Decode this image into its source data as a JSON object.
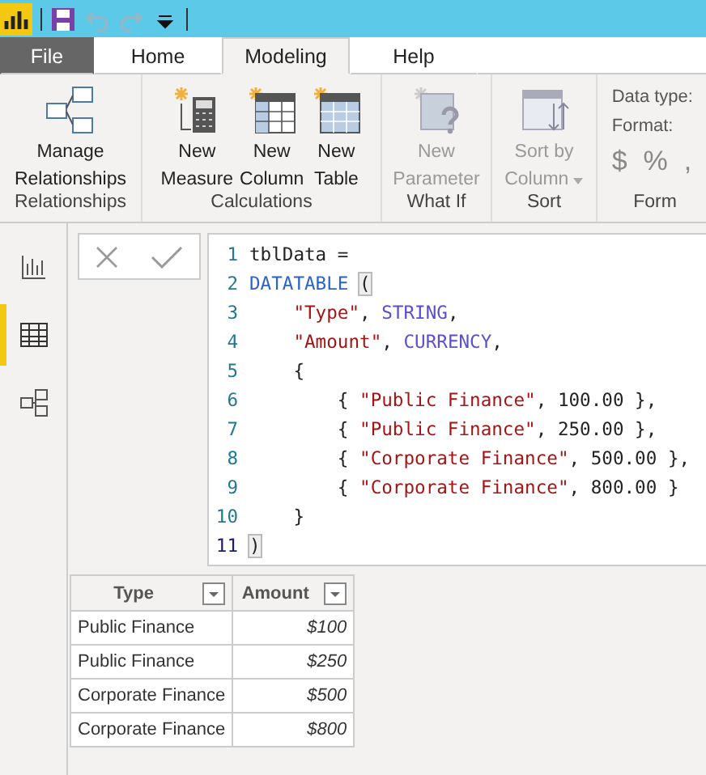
{
  "quick_access": {
    "undo_disabled": true,
    "redo_disabled": true
  },
  "tabs": [
    {
      "label": "File",
      "kind": "file",
      "selected": false
    },
    {
      "label": "Home",
      "kind": "tab",
      "selected": false
    },
    {
      "label": "Modeling",
      "kind": "tab",
      "selected": true
    },
    {
      "label": "Help",
      "kind": "tab",
      "selected": false
    }
  ],
  "ribbon_groups": [
    {
      "label": "Relationships",
      "buttons": [
        {
          "lines": [
            "Manage",
            "Relationships"
          ],
          "disabled": false
        }
      ]
    },
    {
      "label": "Calculations",
      "buttons": [
        {
          "lines": [
            "New",
            "Measure"
          ],
          "disabled": false
        },
        {
          "lines": [
            "New",
            "Column"
          ],
          "disabled": false
        },
        {
          "lines": [
            "New",
            "Table"
          ],
          "disabled": false
        }
      ]
    },
    {
      "label": "What If",
      "buttons": [
        {
          "lines": [
            "New",
            "Parameter"
          ],
          "disabled": true
        }
      ]
    },
    {
      "label": "Sort",
      "buttons": [
        {
          "lines": [
            "Sort by",
            "Column"
          ],
          "disabled": true,
          "dropdown": true
        }
      ]
    },
    {
      "label": "Form",
      "kind": "format",
      "data_type_label": "Data type:",
      "format_label": "Format:",
      "symbols": [
        "$",
        "%",
        ","
      ]
    }
  ],
  "sidebar": [
    {
      "selected": false
    },
    {
      "selected": true
    },
    {
      "selected": false
    }
  ],
  "formula_bar": {
    "lines": [
      {
        "number": "1",
        "tokens": [
          {
            "text": "tblData =",
            "kind": "plain"
          }
        ]
      },
      {
        "number": "2",
        "tokens": [
          {
            "text": "DATATABLE",
            "kind": "keyword"
          },
          {
            "text": "(",
            "kind": "bracket"
          }
        ]
      },
      {
        "number": "3",
        "tokens": [
          {
            "text": "    \"Type\"",
            "kind": "string"
          },
          {
            "text": ", ",
            "kind": "plain"
          },
          {
            "text": "STRING",
            "kind": "type"
          },
          {
            "text": ",",
            "kind": "plain"
          }
        ]
      },
      {
        "number": "4",
        "tokens": [
          {
            "text": "    \"Amount\"",
            "kind": "string"
          },
          {
            "text": ", ",
            "kind": "plain"
          },
          {
            "text": "CURRENCY",
            "kind": "type"
          },
          {
            "text": ",",
            "kind": "plain"
          }
        ]
      },
      {
        "number": "5",
        "tokens": [
          {
            "text": "    {",
            "kind": "plain"
          }
        ]
      },
      {
        "number": "6",
        "tokens": [
          {
            "text": "        { ",
            "kind": "plain"
          },
          {
            "text": "\"Public Finance\"",
            "kind": "string"
          },
          {
            "text": ", 100.00 },",
            "kind": "plain"
          }
        ]
      },
      {
        "number": "7",
        "tokens": [
          {
            "text": "        { ",
            "kind": "plain"
          },
          {
            "text": "\"Public Finance\"",
            "kind": "string"
          },
          {
            "text": ", 250.00 },",
            "kind": "plain"
          }
        ]
      },
      {
        "number": "8",
        "tokens": [
          {
            "text": "        { ",
            "kind": "plain"
          },
          {
            "text": "\"Corporate Finance\"",
            "kind": "string"
          },
          {
            "text": ", 500.00 },",
            "kind": "plain"
          }
        ]
      },
      {
        "number": "9",
        "tokens": [
          {
            "text": "        { ",
            "kind": "plain"
          },
          {
            "text": "\"Corporate Finance\"",
            "kind": "string"
          },
          {
            "text": ", 800.00 }",
            "kind": "plain"
          }
        ]
      },
      {
        "number": "10",
        "tokens": [
          {
            "text": "    }",
            "kind": "plain"
          }
        ]
      },
      {
        "number": "11",
        "tokens": [
          {
            "text": ")",
            "kind": "bracket"
          }
        ]
      }
    ]
  },
  "table": {
    "columns": [
      "Type",
      "Amount"
    ],
    "rows": [
      [
        "Public Finance",
        "$100"
      ],
      [
        "Public Finance",
        "$250"
      ],
      [
        "Corporate Finance",
        "$500"
      ],
      [
        "Corporate Finance",
        "$800"
      ]
    ]
  }
}
